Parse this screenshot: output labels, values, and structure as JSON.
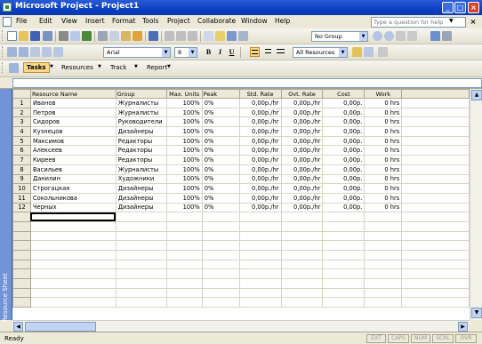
{
  "window": {
    "title": "Microsoft Project - Project1"
  },
  "menu": {
    "items": [
      "File",
      "Edit",
      "View",
      "Insert",
      "Format",
      "Tools",
      "Project",
      "Collaborate",
      "Window",
      "Help"
    ],
    "help_placeholder": "Type a question for help"
  },
  "toolbar_standard": {
    "group_value": "No Group"
  },
  "toolbar_formatting": {
    "font_value": "Arial",
    "size_value": "8",
    "filter_value": "All Resources",
    "bold": "B",
    "italic": "I",
    "underline": "U"
  },
  "toolbar_guide": {
    "tabs": [
      "Tasks",
      "Resources",
      "Track",
      "Report"
    ],
    "active": "Tasks"
  },
  "view_bar": {
    "label": "Resource Sheet"
  },
  "sheet": {
    "columns": [
      "Resource Name",
      "Group",
      "Max. Units",
      "Peak",
      "Std. Rate",
      "Ovt. Rate",
      "Cost",
      "Work"
    ],
    "rows": [
      [
        "1",
        "Иванов",
        "Журналисты",
        "100%",
        "0%",
        "0,00р./hr",
        "0,00р./hr",
        "0,00р.",
        "0 hrs"
      ],
      [
        "2",
        "Петров",
        "Журналисты",
        "100%",
        "0%",
        "0,00р./hr",
        "0,00р./hr",
        "0,00р.",
        "0 hrs"
      ],
      [
        "3",
        "Сидоров",
        "Руководители",
        "100%",
        "0%",
        "0,00р./hr",
        "0,00р./hr",
        "0,00р.",
        "0 hrs"
      ],
      [
        "4",
        "Кузнецов",
        "Дизайнеры",
        "100%",
        "0%",
        "0,00р./hr",
        "0,00р./hr",
        "0,00р.",
        "0 hrs"
      ],
      [
        "5",
        "Максимов",
        "Редакторы",
        "100%",
        "0%",
        "0,00р./hr",
        "0,00р./hr",
        "0,00р.",
        "0 hrs"
      ],
      [
        "6",
        "Алексеев",
        "Редакторы",
        "100%",
        "0%",
        "0,00р./hr",
        "0,00р./hr",
        "0,00р.",
        "0 hrs"
      ],
      [
        "7",
        "Киреев",
        "Редакторы",
        "100%",
        "0%",
        "0,00р./hr",
        "0,00р./hr",
        "0,00р.",
        "0 hrs"
      ],
      [
        "8",
        "Васильев",
        "Журналисты",
        "100%",
        "0%",
        "0,00р./hr",
        "0,00р./hr",
        "0,00р.",
        "0 hrs"
      ],
      [
        "9",
        "Данилин",
        "Художники",
        "100%",
        "0%",
        "0,00р./hr",
        "0,00р./hr",
        "0,00р.",
        "0 hrs"
      ],
      [
        "10",
        "Строгацкая",
        "Дизайнеры",
        "100%",
        "0%",
        "0,00р./hr",
        "0,00р./hr",
        "0,00р.",
        "0 hrs"
      ],
      [
        "11",
        "Сокольникова",
        "Дизайнеры",
        "100%",
        "0%",
        "0,00р./hr",
        "0,00р./hr",
        "0,00р.",
        "0 hrs"
      ],
      [
        "12",
        "Черных",
        "Дизайнеры",
        "100%",
        "0%",
        "0,00р./hr",
        "0,00р./hr",
        "0,00р.",
        "0 hrs"
      ]
    ]
  },
  "status": {
    "ready": "Ready",
    "indicators": [
      "EXT",
      "CAPS",
      "NUM",
      "SCRL",
      "OVR"
    ]
  },
  "colors": {
    "title_bar": "#0a3fc2",
    "view_bar": "#7193d8",
    "active_button": "#f8d88a"
  }
}
